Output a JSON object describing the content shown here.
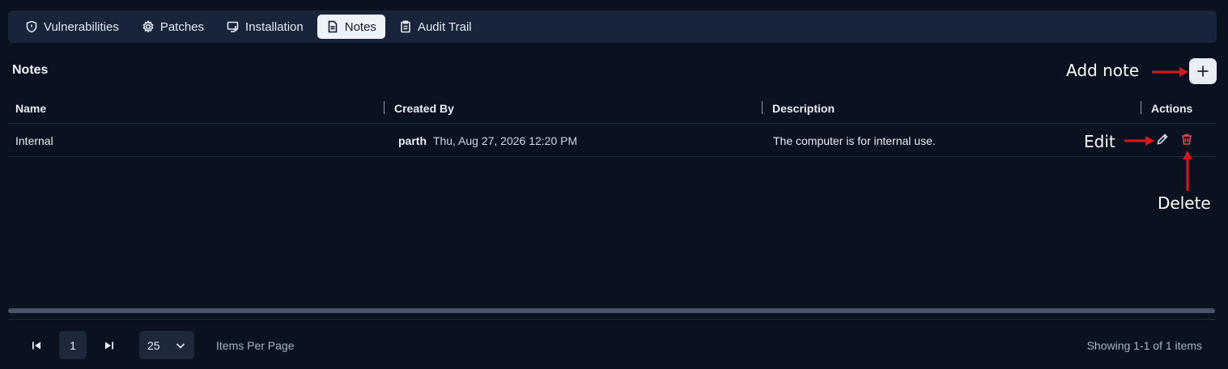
{
  "tabs": [
    {
      "label": "Vulnerabilities",
      "icon": "shield-icon",
      "active": false
    },
    {
      "label": "Patches",
      "icon": "gear-icon",
      "active": false
    },
    {
      "label": "Installation",
      "icon": "monitor-download-icon",
      "active": false
    },
    {
      "label": "Notes",
      "icon": "document-icon",
      "active": true
    },
    {
      "label": "Audit Trail",
      "icon": "clipboard-icon",
      "active": false
    }
  ],
  "section": {
    "title": "Notes"
  },
  "table": {
    "columns": [
      "Name",
      "Created By",
      "Description",
      "Actions"
    ],
    "rows": [
      {
        "name": "Internal",
        "created_by_user": "parth",
        "created_at": "Thu, Aug 27, 2026 12:20 PM",
        "description": "The computer is for internal use."
      }
    ]
  },
  "annotations": {
    "add_note": "Add note",
    "edit": "Edit",
    "delete": "Delete"
  },
  "pagination": {
    "current_page": "1",
    "per_page": "25",
    "per_page_label": "Items Per Page",
    "showing": "Showing 1-1 of 1 items"
  },
  "colors": {
    "background": "#0a1220",
    "tabbar": "#18243a",
    "active_tab": "#eef1f7",
    "delete_red": "#e0484f",
    "annotation_arrow": "#e0141b"
  }
}
